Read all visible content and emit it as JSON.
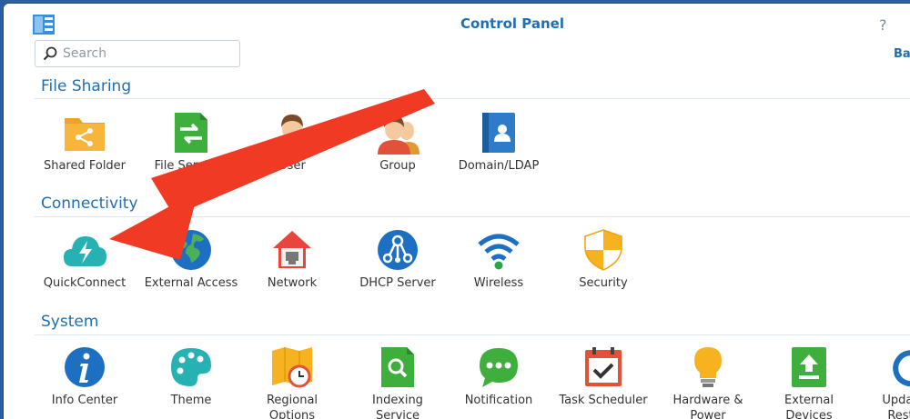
{
  "window": {
    "title": "Control Panel",
    "help_label": "?"
  },
  "search": {
    "placeholder": "Search"
  },
  "header": {
    "back_label": "Ba"
  },
  "sections": {
    "file_sharing": {
      "title": "File Sharing",
      "items": [
        {
          "label": "Shared Folder",
          "icon": "shared-folder-icon"
        },
        {
          "label": "File Services",
          "icon": "file-services-icon"
        },
        {
          "label": "User",
          "icon": "user-icon"
        },
        {
          "label": "Group",
          "icon": "group-icon"
        },
        {
          "label": "Domain/LDAP",
          "icon": "domain-ldap-icon"
        }
      ]
    },
    "connectivity": {
      "title": "Connectivity",
      "items": [
        {
          "label": "QuickConnect",
          "icon": "quickconnect-icon"
        },
        {
          "label": "External Access",
          "icon": "external-access-icon"
        },
        {
          "label": "Network",
          "icon": "network-icon"
        },
        {
          "label": "DHCP Server",
          "icon": "dhcp-server-icon"
        },
        {
          "label": "Wireless",
          "icon": "wireless-icon"
        },
        {
          "label": "Security",
          "icon": "security-icon"
        }
      ]
    },
    "system": {
      "title": "System",
      "items": [
        {
          "label": "Info Center",
          "icon": "info-center-icon"
        },
        {
          "label": "Theme",
          "icon": "theme-icon"
        },
        {
          "label": "Regional Options",
          "icon": "regional-options-icon"
        },
        {
          "label": "Indexing Service",
          "icon": "indexing-service-icon"
        },
        {
          "label": "Notification",
          "icon": "notification-icon"
        },
        {
          "label": "Task Scheduler",
          "icon": "task-scheduler-icon"
        },
        {
          "label": "Hardware & Power",
          "icon": "hardware-power-icon"
        },
        {
          "label": "External Devices",
          "icon": "external-devices-icon"
        },
        {
          "label": "Update & Restore",
          "icon": "update-restore-icon"
        }
      ]
    }
  },
  "colors": {
    "accent": "#1f6eb2",
    "arrow": "#f03a24",
    "frame": "#2a5fa3"
  }
}
